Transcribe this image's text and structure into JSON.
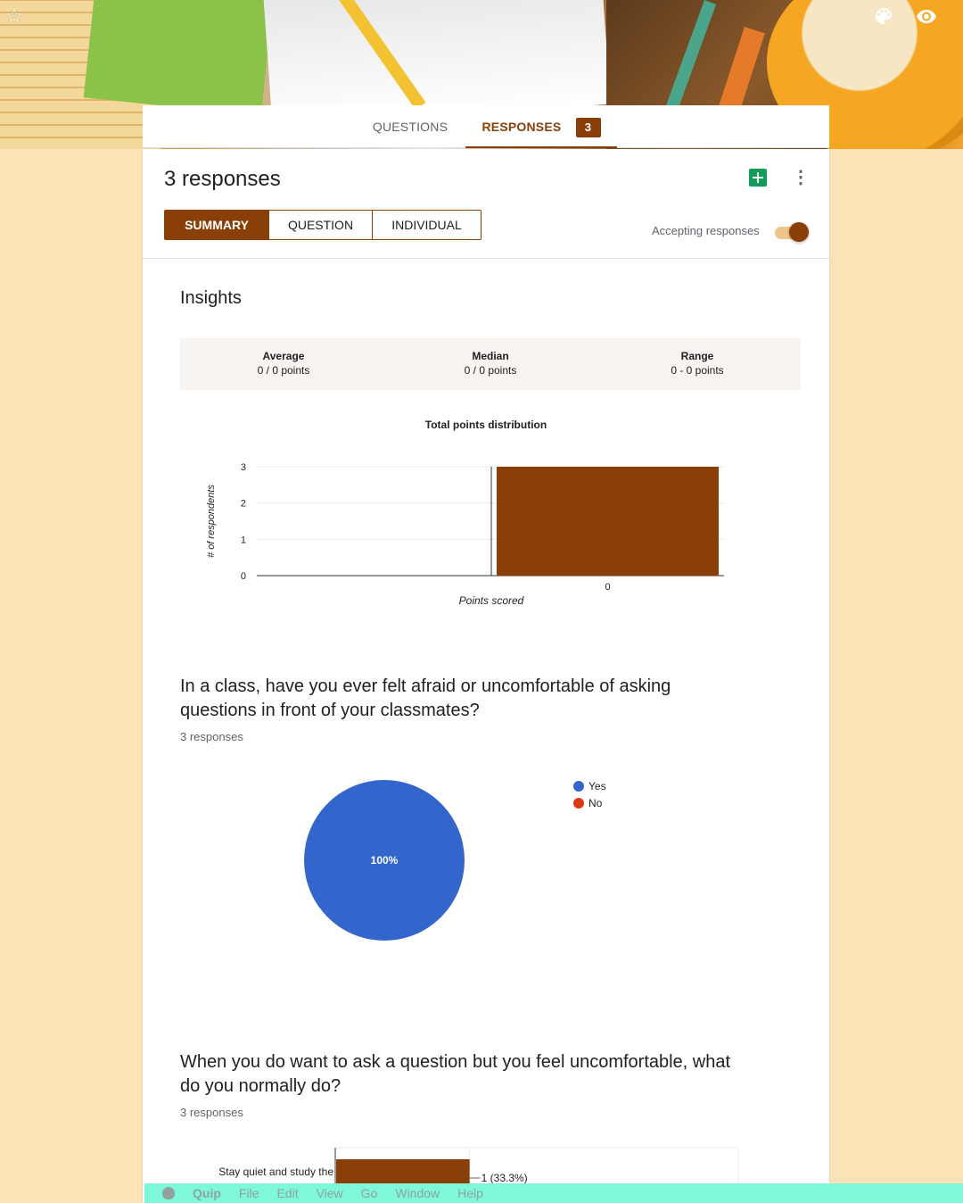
{
  "tabs": {
    "questions_label": "QUESTIONS",
    "responses_label": "RESPONSES",
    "responses_badge": "3"
  },
  "header": {
    "title": "3 responses",
    "views": [
      "SUMMARY",
      "QUESTION",
      "INDIVIDUAL"
    ],
    "accepting_label": "Accepting responses",
    "accepting_on": true
  },
  "insights": {
    "title": "Insights",
    "average_label": "Average",
    "average_value": "0 / 0 points",
    "median_label": "Median",
    "median_value": "0 / 0 points",
    "range_label": "Range",
    "range_value": "0 - 0 points"
  },
  "distribution": {
    "chart_title": "Total points distribution"
  },
  "question1": {
    "title": "In a class, have you ever felt afraid or uncomfortable of asking questions in front of your classmates?",
    "responses": "3 responses"
  },
  "question2": {
    "title": "When you do want to ask a question but you feel uncomfortable, what do you normally do?",
    "responses": "3 responses"
  },
  "menubar": {
    "app": "Quip",
    "items": [
      "File",
      "Edit",
      "View",
      "Go",
      "Window",
      "Help"
    ]
  },
  "colors": {
    "accent": "#8a3f09",
    "pie_yes": "#3366cc",
    "pie_no": "#dc3912",
    "page_bg": "#fbe3b7"
  },
  "chart_data": [
    {
      "type": "bar",
      "title": "Total points distribution",
      "xlabel": "Points scored",
      "ylabel": "# of respondents",
      "categories": [
        "0"
      ],
      "values": [
        3
      ],
      "ylim": [
        0,
        3
      ],
      "yticks": [
        0,
        1,
        2,
        3
      ],
      "grid": true
    },
    {
      "type": "pie",
      "labels": [
        "Yes",
        "No"
      ],
      "values": [
        3,
        0
      ],
      "slice_labels": [
        "100%"
      ],
      "legend": "right"
    },
    {
      "type": "bar",
      "orientation": "horizontal",
      "categories": [
        "Stay quiet and study the"
      ],
      "values": [
        1
      ],
      "data_labels": [
        "1 (33.3%)"
      ]
    }
  ]
}
